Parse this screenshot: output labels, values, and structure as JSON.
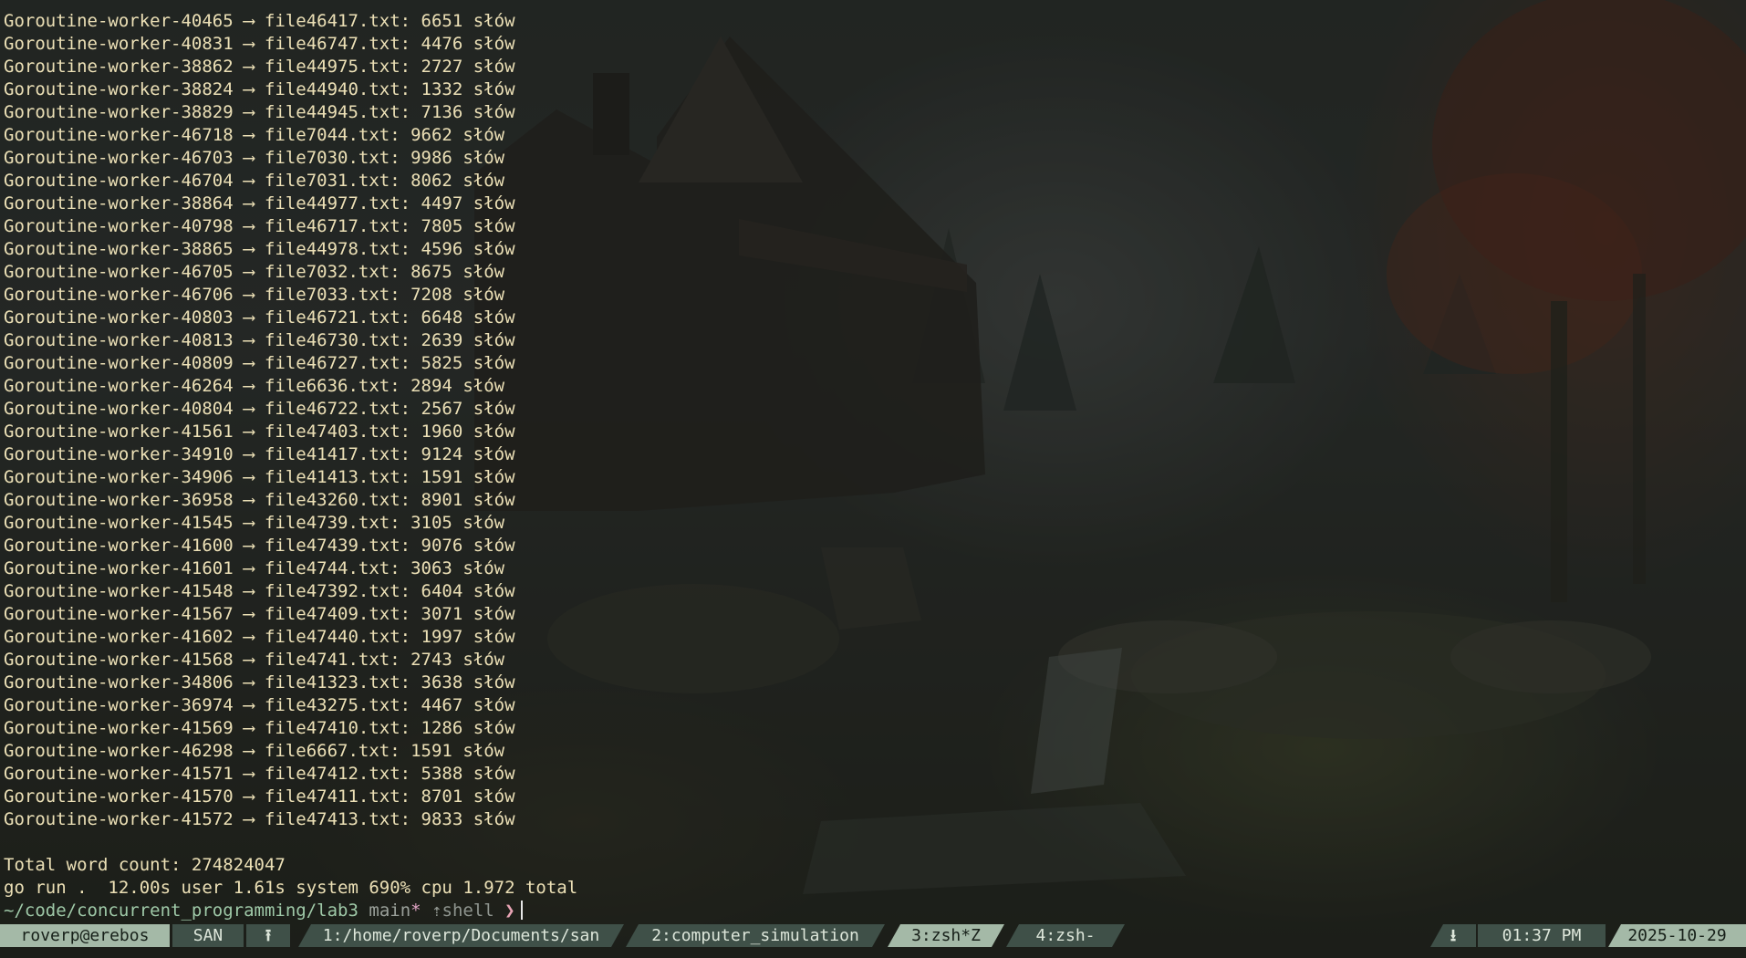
{
  "terminal": {
    "output_lines": [
      "Goroutine-worker-40465 ⟶ file46417.txt: 6651 słów",
      "Goroutine-worker-40831 ⟶ file46747.txt: 4476 słów",
      "Goroutine-worker-38862 ⟶ file44975.txt: 2727 słów",
      "Goroutine-worker-38824 ⟶ file44940.txt: 1332 słów",
      "Goroutine-worker-38829 ⟶ file44945.txt: 7136 słów",
      "Goroutine-worker-46718 ⟶ file7044.txt: 9662 słów",
      "Goroutine-worker-46703 ⟶ file7030.txt: 9986 słów",
      "Goroutine-worker-46704 ⟶ file7031.txt: 8062 słów",
      "Goroutine-worker-38864 ⟶ file44977.txt: 4497 słów",
      "Goroutine-worker-40798 ⟶ file46717.txt: 7805 słów",
      "Goroutine-worker-38865 ⟶ file44978.txt: 4596 słów",
      "Goroutine-worker-46705 ⟶ file7032.txt: 8675 słów",
      "Goroutine-worker-46706 ⟶ file7033.txt: 7208 słów",
      "Goroutine-worker-40803 ⟶ file46721.txt: 6648 słów",
      "Goroutine-worker-40813 ⟶ file46730.txt: 2639 słów",
      "Goroutine-worker-40809 ⟶ file46727.txt: 5825 słów",
      "Goroutine-worker-46264 ⟶ file6636.txt: 2894 słów",
      "Goroutine-worker-40804 ⟶ file46722.txt: 2567 słów",
      "Goroutine-worker-41561 ⟶ file47403.txt: 1960 słów",
      "Goroutine-worker-34910 ⟶ file41417.txt: 9124 słów",
      "Goroutine-worker-34906 ⟶ file41413.txt: 1591 słów",
      "Goroutine-worker-36958 ⟶ file43260.txt: 8901 słów",
      "Goroutine-worker-41545 ⟶ file4739.txt: 3105 słów",
      "Goroutine-worker-41600 ⟶ file47439.txt: 9076 słów",
      "Goroutine-worker-41601 ⟶ file4744.txt: 3063 słów",
      "Goroutine-worker-41548 ⟶ file47392.txt: 6404 słów",
      "Goroutine-worker-41567 ⟶ file47409.txt: 3071 słów",
      "Goroutine-worker-41602 ⟶ file47440.txt: 1997 słów",
      "Goroutine-worker-41568 ⟶ file4741.txt: 2743 słów",
      "Goroutine-worker-34806 ⟶ file41323.txt: 3638 słów",
      "Goroutine-worker-36974 ⟶ file43275.txt: 4467 słów",
      "Goroutine-worker-41569 ⟶ file47410.txt: 1286 słów",
      "Goroutine-worker-46298 ⟶ file6667.txt: 1591 słów",
      "Goroutine-worker-41571 ⟶ file47412.txt: 5388 słów",
      "Goroutine-worker-41570 ⟶ file47411.txt: 8701 słów",
      "Goroutine-worker-41572 ⟶ file47413.txt: 9833 słów"
    ],
    "total_line": "Total word count: 274824047",
    "timing_line": "go run .  12.00s user 1.61s system 690% cpu 1.972 total",
    "prompt": {
      "path": "~/code/concurrent_programming/lab3",
      "branch": "main",
      "dirty_marker": "*",
      "upstream": "⇡shell",
      "chevron": "❯"
    }
  },
  "statusbar": {
    "user_host": "roverp@erebos",
    "session": "SAN",
    "upload_icon": "upload-icon",
    "windows": [
      {
        "label": "1:/home/roverp/Documents/san",
        "active": false
      },
      {
        "label": "2:computer_simulation",
        "active": false
      },
      {
        "label": "3:zsh*Z",
        "active": true
      },
      {
        "label": "4:zsh-",
        "active": false
      }
    ],
    "download_icon": "download-icon",
    "time": "01:37 PM",
    "date": "2025-10-29"
  },
  "colors": {
    "output_text": "#ece0b6",
    "prompt_path": "#9fc9a8",
    "status_active": "#a4b9a7",
    "status_inactive": "#3f5048"
  }
}
